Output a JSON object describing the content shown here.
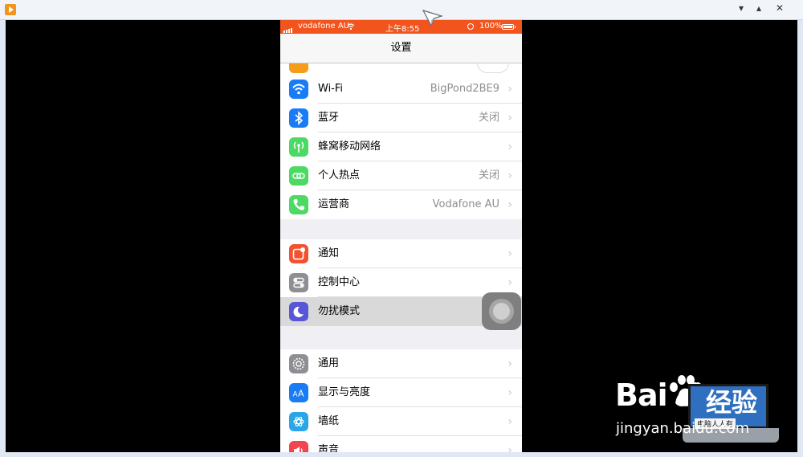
{
  "window": {
    "minimize": "▾",
    "restore": "▴",
    "close": "✕"
  },
  "status_bar": {
    "carrier": "vodafone AU",
    "time": "上午8:55",
    "battery": "100%"
  },
  "nav": {
    "title": "设置"
  },
  "groups": [
    {
      "rows": [
        {
          "label": "Wi-Fi",
          "value": "BigPond2BE9",
          "icon": "wifi-icon",
          "color": "#1a7cf5"
        },
        {
          "label": "蓝牙",
          "value": "关闭",
          "icon": "bluetooth-icon",
          "color": "#1a7cf5"
        },
        {
          "label": "蜂窝移动网络",
          "value": "",
          "icon": "cellular-icon",
          "color": "#4cd964"
        },
        {
          "label": "个人热点",
          "value": "关闭",
          "icon": "hotspot-icon",
          "color": "#4cd964"
        },
        {
          "label": "运营商",
          "value": "Vodafone AU",
          "icon": "phone-icon",
          "color": "#4cd964"
        }
      ]
    },
    {
      "rows": [
        {
          "label": "通知",
          "value": "",
          "icon": "notifications-icon",
          "color": "#f2522e"
        },
        {
          "label": "控制中心",
          "value": "",
          "icon": "control-center-icon",
          "color": "#8e8e93"
        },
        {
          "label": "勿扰模式",
          "value": "",
          "icon": "moon-icon",
          "color": "#5856d6"
        }
      ]
    },
    {
      "rows": [
        {
          "label": "通用",
          "value": "",
          "icon": "gear-icon",
          "color": "#8e8e93"
        },
        {
          "label": "显示与亮度",
          "value": "",
          "icon": "brightness-icon",
          "color": "#1a7cf5"
        },
        {
          "label": "墙纸",
          "value": "",
          "icon": "wallpaper-icon",
          "color": "#2aa6e8"
        },
        {
          "label": "声音",
          "value": "",
          "icon": "sound-icon",
          "color": "#f2454f"
        }
      ]
    }
  ],
  "watermark": {
    "brand": "Bai  du",
    "cn": "经验",
    "sub": "jingyan.baidu.com",
    "laptop": "电脑人人有"
  }
}
